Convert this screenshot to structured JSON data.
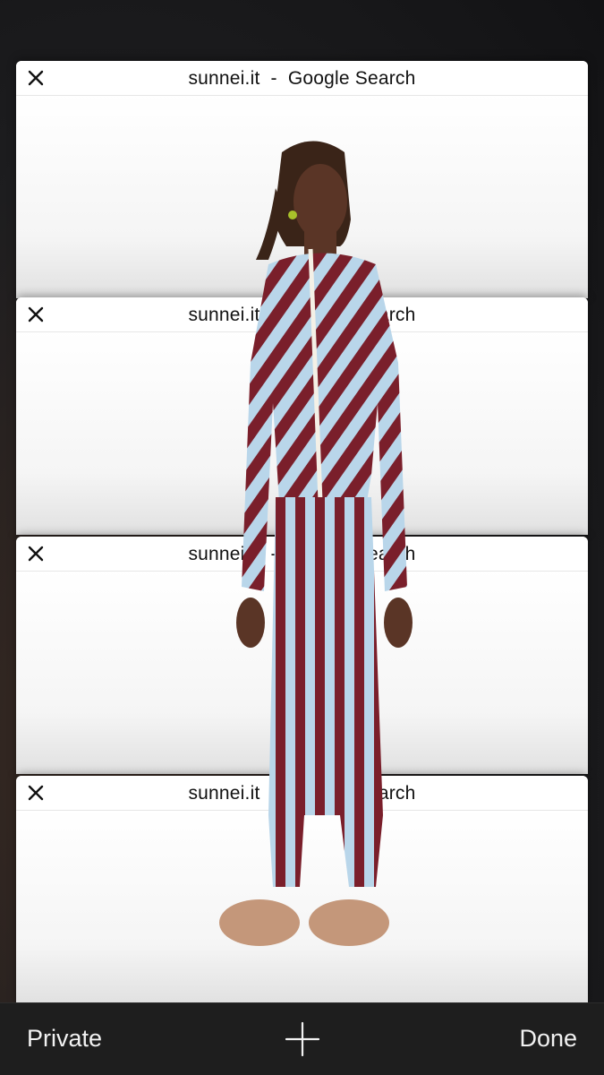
{
  "tabs": [
    {
      "title": "sunnei.it  -  Google Search"
    },
    {
      "title": "sunnei.it  -  Google Search"
    },
    {
      "title": "sunnei.it  -  Google Search"
    },
    {
      "title": "sunnei.it  -  Google Search"
    }
  ],
  "toolbar": {
    "private_label": "Private",
    "done_label": "Done",
    "add_icon": "plus-icon"
  },
  "colors": {
    "stripe_dark": "#7a1f2b",
    "stripe_light": "#b9d6ea",
    "toolbar_bg": "#1e1e1e"
  }
}
